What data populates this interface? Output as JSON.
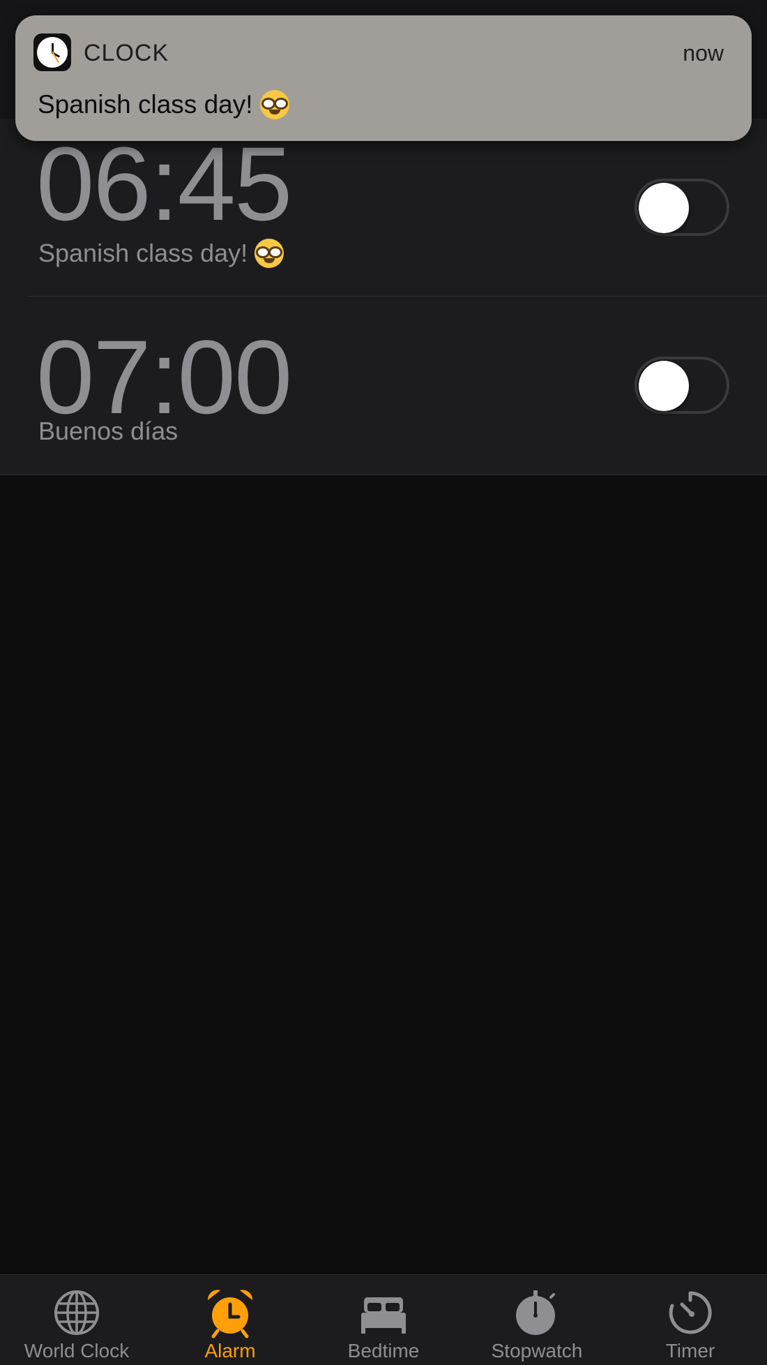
{
  "colors": {
    "accent": "#ff9f0a",
    "inactive": "#8e8e93",
    "background": "#0d0d0e",
    "list_bg": "#1c1c1e",
    "notification_bg": "#a19e99"
  },
  "notification": {
    "app_icon": "clock-app-icon",
    "app_name": "CLOCK",
    "time": "now",
    "body": "Spanish class day!",
    "emoji": "nerd-face-emoji"
  },
  "alarms": [
    {
      "time": "06:45",
      "label": "Spanish class day!",
      "emoji": "nerd-face-emoji",
      "enabled": false
    },
    {
      "time": "07:00",
      "label": "Buenos días",
      "enabled": false
    }
  ],
  "tab_bar": {
    "active": "Alarm",
    "tabs": [
      {
        "label": "World Clock",
        "icon": "globe-icon"
      },
      {
        "label": "Alarm",
        "icon": "alarm-clock-icon"
      },
      {
        "label": "Bedtime",
        "icon": "bed-icon"
      },
      {
        "label": "Stopwatch",
        "icon": "stopwatch-icon"
      },
      {
        "label": "Timer",
        "icon": "timer-icon"
      }
    ]
  }
}
